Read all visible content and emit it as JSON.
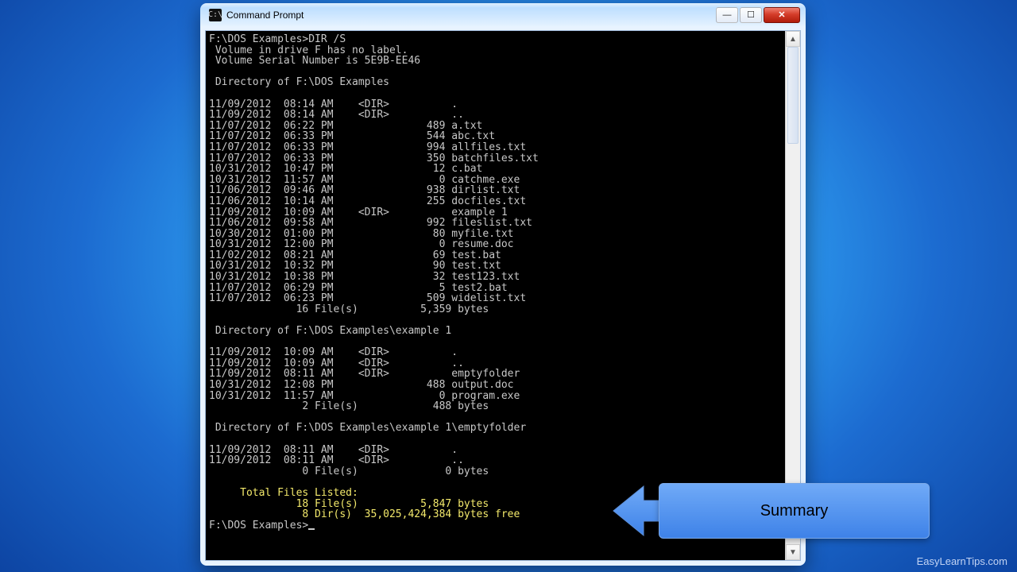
{
  "window": {
    "title": "Command Prompt"
  },
  "buttons": {
    "min_glyph": "—",
    "max_glyph": "☐",
    "close_glyph": "✕"
  },
  "prompt": {
    "command_line": "F:\\DOS Examples>DIR /S",
    "vol1": " Volume in drive F has no label.",
    "vol2": " Volume Serial Number is 5E9B-EE46",
    "dir1_hdr": " Directory of F:\\DOS Examples",
    "dir1": [
      "11/09/2012  08:14 AM    <DIR>          .",
      "11/09/2012  08:14 AM    <DIR>          ..",
      "11/07/2012  06:22 PM               489 a.txt",
      "11/07/2012  06:33 PM               544 abc.txt",
      "11/07/2012  06:33 PM               994 allfiles.txt",
      "11/07/2012  06:33 PM               350 batchfiles.txt",
      "10/31/2012  10:47 PM                12 c.bat",
      "10/31/2012  11:57 AM                 0 catchme.exe",
      "11/06/2012  09:46 AM               938 dirlist.txt",
      "11/06/2012  10:14 AM               255 docfiles.txt",
      "11/09/2012  10:09 AM    <DIR>          example 1",
      "11/06/2012  09:58 AM               992 fileslist.txt",
      "10/30/2012  01:00 PM                80 myfile.txt",
      "10/31/2012  12:00 PM                 0 resume.doc",
      "11/02/2012  08:21 AM                69 test.bat",
      "10/31/2012  10:32 PM                90 test.txt",
      "10/31/2012  10:38 PM                32 test123.txt",
      "11/07/2012  06:29 PM                 5 test2.bat",
      "11/07/2012  06:23 PM               509 widelist.txt",
      "              16 File(s)          5,359 bytes"
    ],
    "dir2_hdr": " Directory of F:\\DOS Examples\\example 1",
    "dir2": [
      "11/09/2012  10:09 AM    <DIR>          .",
      "11/09/2012  10:09 AM    <DIR>          ..",
      "11/09/2012  08:11 AM    <DIR>          emptyfolder",
      "10/31/2012  12:08 PM               488 output.doc",
      "10/31/2012  11:57 AM                 0 program.exe",
      "               2 File(s)            488 bytes"
    ],
    "dir3_hdr": " Directory of F:\\DOS Examples\\example 1\\emptyfolder",
    "dir3": [
      "11/09/2012  08:11 AM    <DIR>          .",
      "11/09/2012  08:11 AM    <DIR>          ..",
      "               0 File(s)              0 bytes"
    ],
    "totals": [
      "     Total Files Listed:",
      "              18 File(s)          5,847 bytes",
      "               8 Dir(s)  35,025,424,384 bytes free"
    ],
    "next_prompt": "F:\\DOS Examples>"
  },
  "callout": {
    "label": "Summary"
  },
  "watermark": "EasyLearnTips.com"
}
